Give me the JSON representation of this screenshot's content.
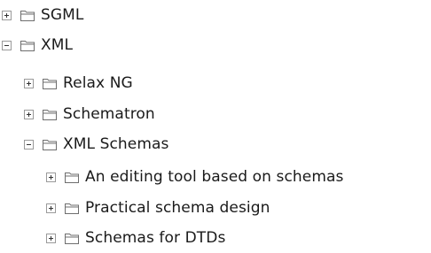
{
  "tree": {
    "nodes": [
      {
        "label": "SGML",
        "state": "collapsed",
        "icon": "folder-icon"
      },
      {
        "label": "XML",
        "state": "expanded",
        "icon": "folder-icon"
      },
      {
        "label": "Relax NG",
        "state": "collapsed",
        "icon": "folder-icon"
      },
      {
        "label": "Schematron",
        "state": "collapsed",
        "icon": "folder-icon"
      },
      {
        "label": "XML Schemas",
        "state": "expanded",
        "icon": "folder-icon"
      },
      {
        "label": "An editing tool based on schemas",
        "state": "collapsed",
        "icon": "folder-icon"
      },
      {
        "label": "Practical schema design",
        "state": "collapsed",
        "icon": "folder-icon"
      },
      {
        "label": "Schemas for DTDs",
        "state": "collapsed",
        "icon": "folder-icon"
      }
    ]
  },
  "colors": {
    "text": "#1a1a1a",
    "toggle_border": "#9a9a9a",
    "folder_stroke": "#6e6e6e"
  }
}
